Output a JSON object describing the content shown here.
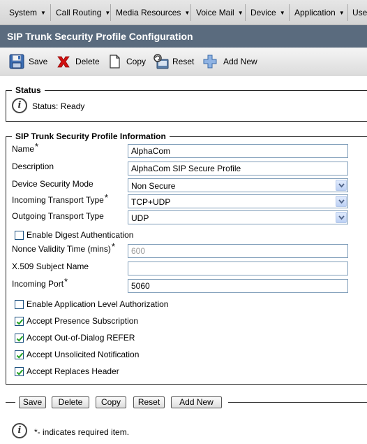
{
  "menu": {
    "items": [
      {
        "label": "System"
      },
      {
        "label": "Call Routing"
      },
      {
        "label": "Media Resources"
      },
      {
        "label": "Voice Mail"
      },
      {
        "label": "Device"
      },
      {
        "label": "Application"
      },
      {
        "label": "User"
      }
    ]
  },
  "page_title": "SIP Trunk Security Profile Configuration",
  "toolbar": {
    "save_label": "Save",
    "delete_label": "Delete",
    "copy_label": "Copy",
    "reset_label": "Reset",
    "add_new_label": "Add New"
  },
  "status": {
    "legend": "Status",
    "text": "Status: Ready"
  },
  "info": {
    "legend": "SIP Trunk Security Profile Information",
    "required_mark": "*",
    "name_label": "Name",
    "name_value": "AlphaCom",
    "description_label": "Description",
    "description_value": "AlphaCom SIP Secure Profile",
    "device_security_mode_label": "Device Security Mode",
    "device_security_mode_value": "Non Secure",
    "incoming_transport_label": "Incoming Transport Type",
    "incoming_transport_value": "TCP+UDP",
    "outgoing_transport_label": "Outgoing Transport Type",
    "outgoing_transport_value": "UDP",
    "digest_auth_label": "Enable Digest Authentication",
    "nonce_label": "Nonce Validity Time (mins)",
    "nonce_value": "600",
    "x509_label": "X.509 Subject Name",
    "x509_value": "",
    "incoming_port_label": "Incoming Port",
    "incoming_port_value": "5060",
    "app_level_auth_label": "Enable Application Level Authorization",
    "presence_label": "Accept Presence Subscription",
    "ood_refer_label": "Accept Out-of-Dialog REFER",
    "unsolicited_label": "Accept Unsolicited Notification",
    "replaces_label": "Accept Replaces Header"
  },
  "checkboxes": {
    "digest_auth": false,
    "app_level_auth": false,
    "presence": true,
    "ood_refer": true,
    "unsolicited": true,
    "replaces": true
  },
  "bottom_buttons": {
    "save": "Save",
    "delete": "Delete",
    "copy": "Copy",
    "reset": "Reset",
    "add_new": "Add New"
  },
  "footer": {
    "required_note": "*- indicates required item."
  },
  "colors": {
    "title_band": "#5a6b7e",
    "delete_red": "#d21010",
    "checkbox_green": "#21a121"
  }
}
